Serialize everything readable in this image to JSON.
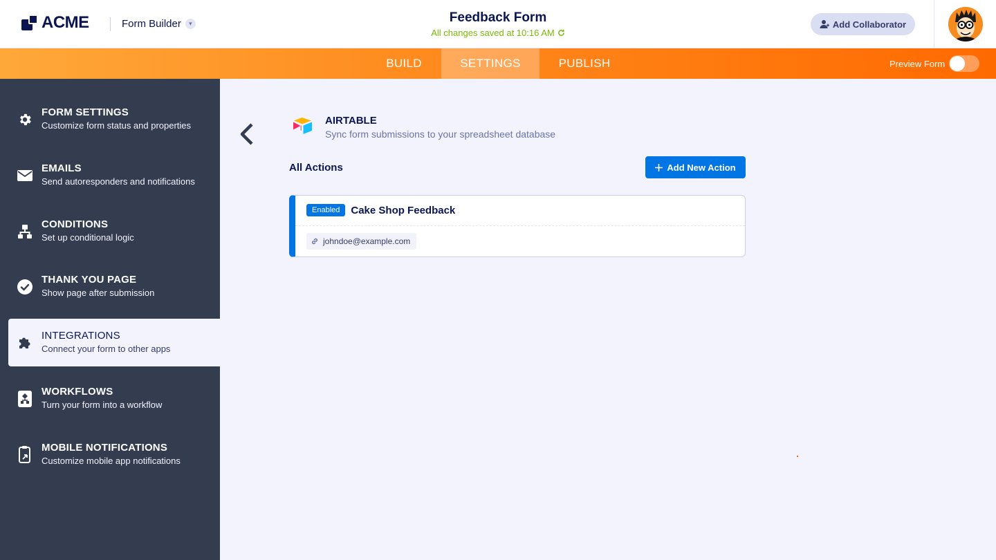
{
  "header": {
    "brand": "ACME",
    "app_switcher": "Form Builder",
    "form_title": "Feedback Form",
    "save_status": "All changes saved at 10:16 AM",
    "collaborator_button": "Add Collaborator"
  },
  "nav": {
    "tabs": [
      {
        "label": "BUILD"
      },
      {
        "label": "SETTINGS",
        "active": true
      },
      {
        "label": "PUBLISH"
      }
    ],
    "preview_label": "Preview Form",
    "preview_on": false
  },
  "sidebar": {
    "items": [
      {
        "title": "FORM SETTINGS",
        "subtitle": "Customize form status and properties",
        "icon": "gear-icon"
      },
      {
        "title": "EMAILS",
        "subtitle": "Send autoresponders and notifications",
        "icon": "envelope-icon"
      },
      {
        "title": "CONDITIONS",
        "subtitle": "Set up conditional logic",
        "icon": "sitemap-icon"
      },
      {
        "title": "THANK YOU PAGE",
        "subtitle": "Show page after submission",
        "icon": "check-circle-icon"
      },
      {
        "title": "INTEGRATIONS",
        "subtitle": "Connect your form to other apps",
        "icon": "puzzle-icon",
        "active": true
      },
      {
        "title": "WORKFLOWS",
        "subtitle": "Turn your form into a workflow",
        "icon": "workflow-icon"
      },
      {
        "title": "MOBILE NOTIFICATIONS",
        "subtitle": "Customize mobile app notifications",
        "icon": "mobile-icon"
      }
    ]
  },
  "integration": {
    "name": "AIRTABLE",
    "description": "Sync form submissions to your spreadsheet database",
    "actions_heading": "All Actions",
    "add_action_button": "Add New Action",
    "actions": [
      {
        "status": "Enabled",
        "title": "Cake Shop Feedback",
        "account": "johndoe@example.com"
      }
    ]
  },
  "colors": {
    "accent": "#0075e3",
    "sidebar_bg": "#343c4f",
    "nav_gradient_start": "#ffa83a",
    "nav_gradient_end": "#ff6a00",
    "saved_green": "#78bb07"
  }
}
